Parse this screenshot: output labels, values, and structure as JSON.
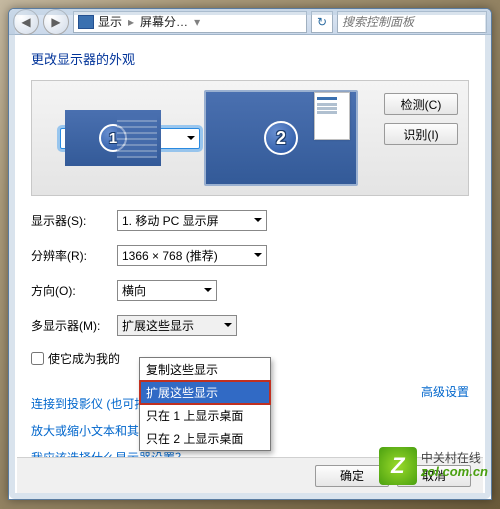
{
  "address": {
    "segment1": "显示",
    "segment2": "屏幕分…"
  },
  "search_placeholder": "搜索控制面板",
  "heading": "更改显示器的外观",
  "monitors": {
    "m1": "1",
    "m2": "2"
  },
  "buttons": {
    "detect": "检测(C)",
    "identify": "识别(I)",
    "ok": "确定",
    "cancel": "取消"
  },
  "labels": {
    "display": "显示器(S):",
    "resolution": "分辨率(R):",
    "orientation": "方向(O):",
    "multi": "多显示器(M):",
    "main_chk": "使它成为我的"
  },
  "values": {
    "display": "1. 移动 PC 显示屏",
    "resolution": "1366 × 768 (推荐)",
    "orientation": "横向",
    "multi": "扩展这些显示"
  },
  "multi_options": [
    "复制这些显示",
    "扩展这些显示",
    "只在 1 上显示桌面",
    "只在 2 上显示桌面"
  ],
  "links": {
    "advanced": "高级设置",
    "projector": "连接到投影仪 (也可按住 ⊞ 键并点击 P)",
    "textsize": "放大或缩小文本和其他项目",
    "which": "我应该选择什么显示器设置？"
  },
  "watermark": {
    "cn": "中关村在线",
    "en": "zol.com.cn"
  }
}
